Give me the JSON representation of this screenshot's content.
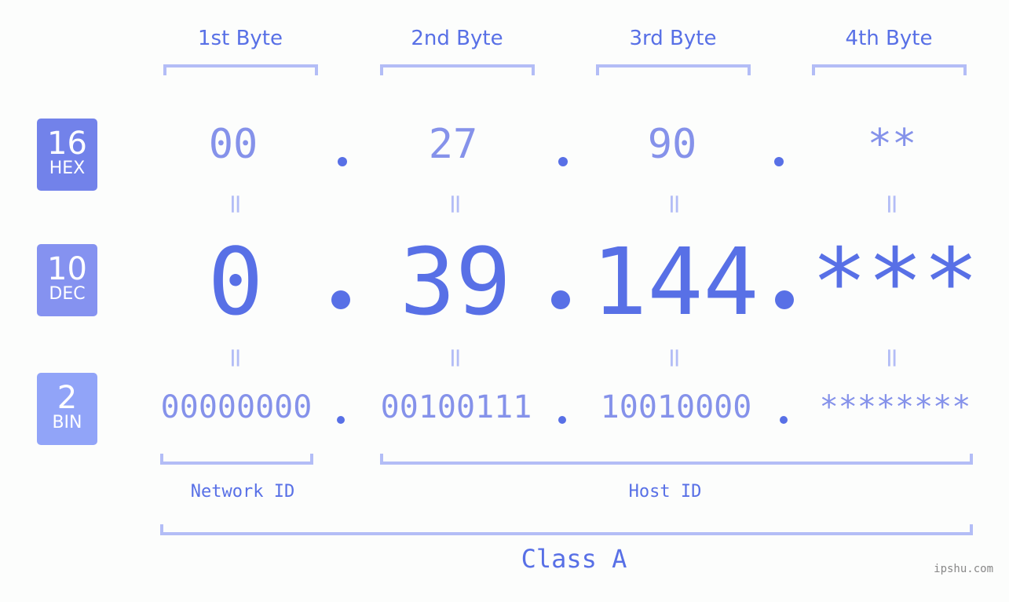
{
  "byte_headers": [
    "1st Byte",
    "2nd Byte",
    "3rd Byte",
    "4th Byte"
  ],
  "badges": {
    "hex": {
      "number": "16",
      "label": "HEX",
      "color": "#7282ea"
    },
    "dec": {
      "number": "10",
      "label": "DEC",
      "color": "#8592f0"
    },
    "bin": {
      "number": "2",
      "label": "BIN",
      "color": "#91a4f8"
    }
  },
  "hex_values": [
    "00",
    "27",
    "90",
    "**"
  ],
  "dec_values": [
    "0",
    "39",
    "144",
    "***"
  ],
  "bin_values": [
    "00000000",
    "00100111",
    "10010000",
    "********"
  ],
  "equals_sign": "=",
  "network_label": "Network ID",
  "host_label": "Host ID",
  "class_label": "Class A",
  "watermark": "ipshu.com",
  "colors": {
    "accent": "#5870e6",
    "secondary": "#8592ea",
    "bracket": "#b3bdf6"
  }
}
